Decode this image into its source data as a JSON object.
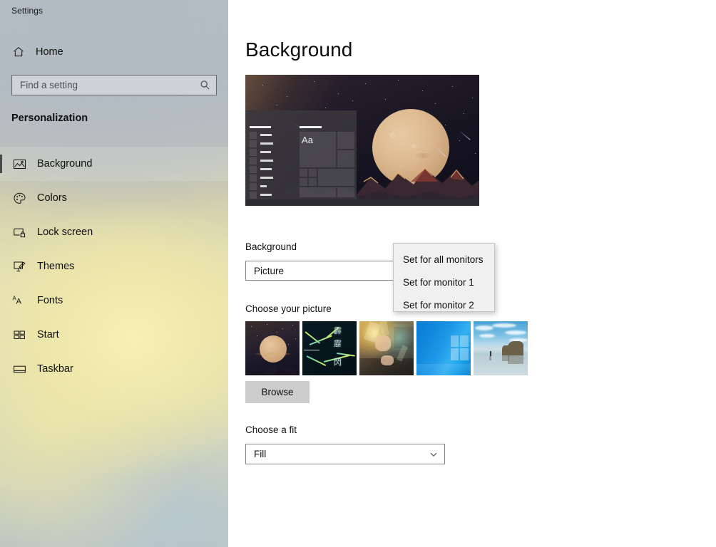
{
  "window": {
    "app_title": "Settings"
  },
  "sidebar": {
    "home": {
      "label": "Home",
      "icon": "home-icon"
    },
    "search": {
      "placeholder": "Find a setting",
      "value": "",
      "icon": "search-icon"
    },
    "group_title": "Personalization",
    "items": [
      {
        "label": "Background",
        "icon": "picture-icon",
        "selected": true
      },
      {
        "label": "Colors",
        "icon": "palette-icon",
        "selected": false
      },
      {
        "label": "Lock screen",
        "icon": "lock-screen-icon",
        "selected": false
      },
      {
        "label": "Themes",
        "icon": "brush-icon",
        "selected": false
      },
      {
        "label": "Fonts",
        "icon": "font-icon",
        "selected": false
      },
      {
        "label": "Start",
        "icon": "start-tiles-icon",
        "selected": false
      },
      {
        "label": "Taskbar",
        "icon": "taskbar-icon",
        "selected": false
      }
    ]
  },
  "main": {
    "page_title": "Background",
    "preview": {
      "alt": "desktop-preview",
      "tile_text": "Aa"
    },
    "background_label": "Background",
    "background_value": "Picture",
    "choose_picture_label": "Choose your picture",
    "thumbnails": [
      {
        "name": "moon-mountains-wallpaper"
      },
      {
        "name": "kanji-lightning-wallpaper",
        "text_lines": [
          "霹",
          "靂",
          "閃"
        ]
      },
      {
        "name": "anime-character-wallpaper"
      },
      {
        "name": "windows-default-blue-wallpaper"
      },
      {
        "name": "beach-rock-arch-wallpaper"
      }
    ],
    "browse_label": "Browse",
    "fit_label": "Choose a fit",
    "fit_value": "Fill"
  },
  "context_menu": {
    "items": [
      {
        "label": "Set for all monitors"
      },
      {
        "label": "Set for monitor 1"
      },
      {
        "label": "Set for monitor 2"
      }
    ]
  },
  "colors": {
    "accent_bar": "#4a4a4a",
    "menu_bg": "#f0f0f0",
    "content_bg": "#ffffff",
    "browse_btn_bg": "#cccccc"
  }
}
